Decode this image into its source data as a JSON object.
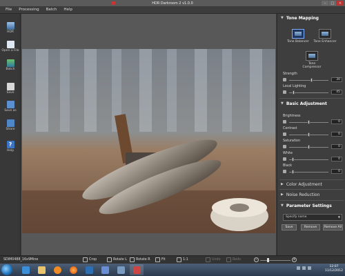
{
  "window": {
    "title": "HDR Darkroom 2 v1.0.0"
  },
  "menu": [
    "File",
    "Processing",
    "Batch",
    "Help"
  ],
  "left_tools": [
    {
      "label": "HDR",
      "icon": "hdr-icon"
    },
    {
      "label": "Open a File",
      "icon": "open-file-icon"
    },
    {
      "label": "Batch",
      "icon": "batch-icon"
    },
    {
      "label": "Save",
      "icon": "save-icon"
    },
    {
      "label": "Save as",
      "icon": "save-as-icon"
    },
    {
      "label": "Share",
      "icon": "share-icon"
    },
    {
      "label": "Help",
      "icon": "help-icon"
    }
  ],
  "panel": {
    "tone_mapping": {
      "title": "Tone Mapping",
      "modes": [
        "Tone Balancer",
        "Tone Enhancer",
        "Tone Compressor"
      ],
      "selected": "Tone Balancer",
      "params": [
        {
          "label": "Strength",
          "value": "30",
          "level": 0.55
        },
        {
          "label": "Local Lighting",
          "value": "45",
          "level": 0.1
        }
      ]
    },
    "basic_adjustment": {
      "title": "Basic Adjustment",
      "params": [
        {
          "label": "Brightness",
          "value": "0",
          "level": 0.5
        },
        {
          "label": "Contrast",
          "value": "0",
          "level": 0.5
        },
        {
          "label": "Saturation",
          "value": "0",
          "level": 0.5
        },
        {
          "label": "White",
          "value": "0",
          "level": 0.1
        },
        {
          "label": "Black",
          "value": "0",
          "level": 0.1
        }
      ]
    },
    "color_adjustment": {
      "title": "Color Adjustment"
    },
    "noise_reduction": {
      "title": "Noise Reduction"
    },
    "parameter_settings": {
      "title": "Parameter Settings",
      "placeholder": "Specify name",
      "buttons": [
        "Save",
        "Remove",
        "Remove All"
      ]
    }
  },
  "status": {
    "filename": "SDIM0488_16x9Mine",
    "tools": [
      "Crop",
      "Rotate L",
      "Rotate R",
      "Fit",
      "1:1",
      "Undo",
      "Redo"
    ],
    "zoom_level": 0.3
  },
  "taskbar": {
    "time": "12:07",
    "date": "11/12/2012",
    "apps": [
      "explorer-icon",
      "media-player-icon",
      "firefox-icon",
      "app-icon",
      "photos-icon",
      "folder-icon",
      "app2-icon",
      "app3-icon"
    ]
  },
  "colors": {
    "accent": "#7fb0ff",
    "panel_bg": "#3e3e3e",
    "canvas_bg": "#585858"
  }
}
